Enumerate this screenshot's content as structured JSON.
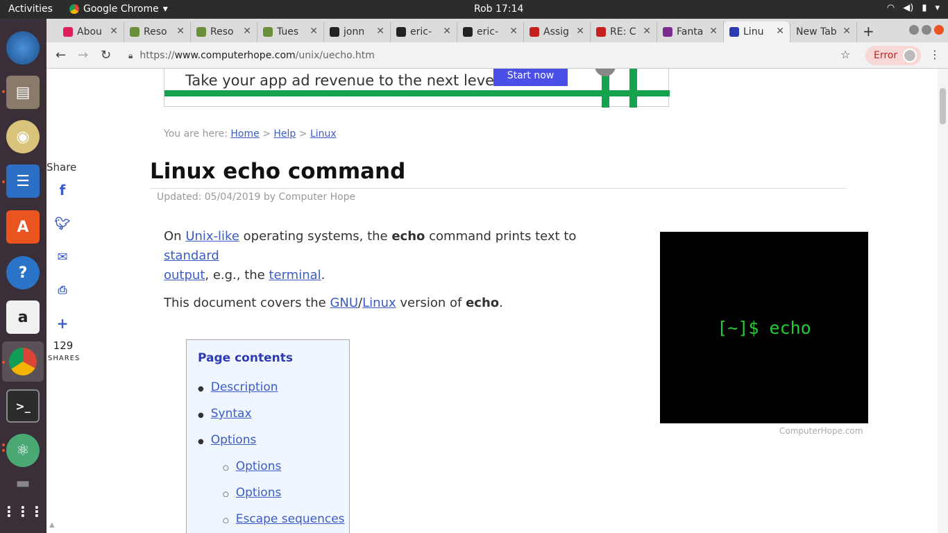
{
  "topbar": {
    "activities": "Activities",
    "app_name": "Google Chrome",
    "clock": "Rob 17:14"
  },
  "tabs": [
    {
      "label": "Abou",
      "icon_color": "#e01e5a"
    },
    {
      "label": "Reso",
      "icon_color": "#6a8f3a"
    },
    {
      "label": "Reso",
      "icon_color": "#6a8f3a"
    },
    {
      "label": "Tues",
      "icon_color": "#6a8f3a"
    },
    {
      "label": "jonn",
      "icon_color": "#222222"
    },
    {
      "label": "eric-",
      "icon_color": "#222222"
    },
    {
      "label": "eric-",
      "icon_color": "#222222"
    },
    {
      "label": "Assig",
      "icon_color": "#c5221f"
    },
    {
      "label": "RE: C",
      "icon_color": "#c5221f"
    },
    {
      "label": "Fanta",
      "icon_color": "#7b2d8e"
    },
    {
      "label": "Linu",
      "icon_color": "#2d3bb3"
    },
    {
      "label": "New Tab",
      "icon_color": ""
    }
  ],
  "address": {
    "scheme": "https://",
    "host": "www.computerhope.com",
    "path": "/unix/uecho.htm"
  },
  "profile": {
    "error_label": "Error"
  },
  "ad": {
    "text": "Take your app ad revenue to the next level.",
    "cta": "Start now"
  },
  "breadcrumb": {
    "prefix": "You are here:",
    "home": "Home",
    "help": "Help",
    "linux": "Linux",
    "sep": ">"
  },
  "share": {
    "label": "Share",
    "count": "129",
    "count_label": "SHARES"
  },
  "article": {
    "title": "Linux echo command",
    "updated": "Updated: 05/04/2019 by Computer Hope",
    "p1": {
      "t1": "On ",
      "l1": "Unix-like",
      "t2": " operating systems, the ",
      "b1": "echo",
      "t3": " command prints text to ",
      "l2a": "standard",
      "l2b": "output",
      "t4": ", e.g., the ",
      "l3": "terminal",
      "t5": "."
    },
    "p2": {
      "t1": "This document covers the ",
      "l1": "GNU",
      "sep": "/",
      "l2": "Linux",
      "t2": " version of ",
      "b1": "echo",
      "t3": "."
    }
  },
  "hero": {
    "text": "[~]$ echo",
    "caption": "ComputerHope.com"
  },
  "toc": {
    "heading": "Page contents",
    "items": [
      "Description",
      "Syntax",
      "Options"
    ],
    "subitems": [
      "Options",
      "Options",
      "Escape sequences"
    ]
  }
}
